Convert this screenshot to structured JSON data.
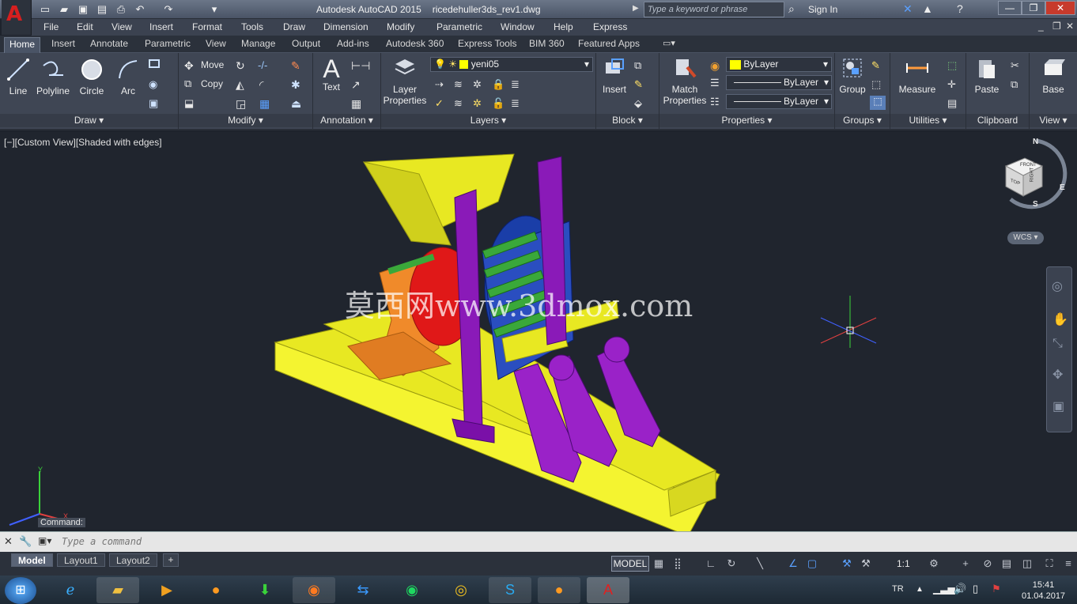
{
  "title_bar": {
    "app_title": "Autodesk AutoCAD 2015",
    "file_name": "ricedehuller3ds_rev1.dwg",
    "search_placeholder": "Type a keyword or phrase",
    "sign_in": "Sign In"
  },
  "menu": [
    "File",
    "Edit",
    "View",
    "Insert",
    "Format",
    "Tools",
    "Draw",
    "Dimension",
    "Modify",
    "Parametric",
    "Window",
    "Help",
    "Express"
  ],
  "tabs": [
    "Home",
    "Insert",
    "Annotate",
    "Parametric",
    "View",
    "Manage",
    "Output",
    "Add-ins",
    "Autodesk 360",
    "Express Tools",
    "BIM 360",
    "Featured Apps"
  ],
  "ribbon": {
    "draw": {
      "title": "Draw",
      "line": "Line",
      "polyline": "Polyline",
      "circle": "Circle",
      "arc": "Arc"
    },
    "modify": {
      "title": "Modify",
      "move": "Move",
      "copy": "Copy"
    },
    "annotation": {
      "title": "Annotation",
      "text": "Text"
    },
    "layers": {
      "title": "Layers",
      "layer_properties": "Layer Properties",
      "current_layer": "yeni05"
    },
    "block": {
      "title": "Block",
      "insert": "Insert"
    },
    "properties": {
      "title": "Properties",
      "match_properties": "Match Properties",
      "color": "ByLayer",
      "linetype": "ByLayer",
      "lineweight": "ByLayer"
    },
    "groups": {
      "title": "Groups",
      "group": "Group"
    },
    "utilities": {
      "title": "Utilities",
      "measure": "Measure"
    },
    "clipboard": {
      "title": "Clipboard",
      "paste": "Paste"
    },
    "view": {
      "title": "View",
      "base": "Base"
    }
  },
  "viewport": {
    "label": "[−][Custom View][Shaded with edges]",
    "watermark": "莫西网www.3dmox.com",
    "wcs": "WCS",
    "cube": {
      "top": "TOP",
      "right": "RIGHT",
      "front": "FRONT"
    },
    "compass": {
      "n": "N",
      "e": "E",
      "s": "S"
    },
    "ucs": {
      "x": "X",
      "y": "Y"
    }
  },
  "command": {
    "label": "Command:",
    "placeholder": "Type a command"
  },
  "layout_tabs": [
    "Model",
    "Layout1",
    "Layout2"
  ],
  "status": {
    "model": "MODEL",
    "scale": "1:1"
  },
  "taskbar": {
    "lang": "TR",
    "time": "15:41",
    "date": "01.04.2017"
  }
}
